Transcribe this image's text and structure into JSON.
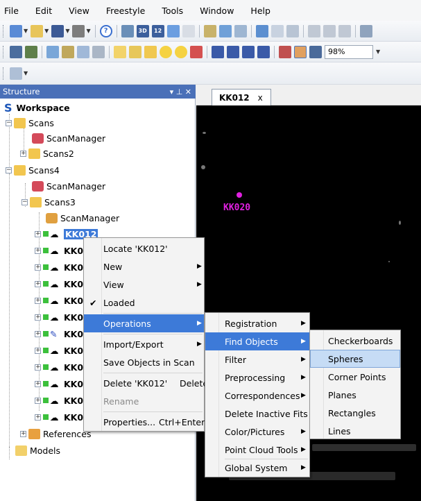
{
  "menubar": [
    "File",
    "Edit",
    "View",
    "Freestyle",
    "Tools",
    "Window",
    "Help"
  ],
  "toolbar": {
    "zoom": "98%",
    "icons": [
      "new-icon",
      "open-icon",
      "save-icon",
      "print-icon",
      "help-icon",
      "scan-icon",
      "3d-icon",
      "12-icon",
      "home-icon"
    ]
  },
  "structure": {
    "title": "Structure",
    "workspace_label": "Workspace",
    "tree": [
      {
        "label": "Scans",
        "bold": false
      },
      {
        "label": "ScanManager",
        "bold": false
      },
      {
        "label": "Scans2",
        "bold": false
      },
      {
        "label": "Scans4",
        "bold": false
      },
      {
        "label": "ScanManager",
        "bold": false
      },
      {
        "label": "Scans3",
        "bold": false
      },
      {
        "label": "ScanManager",
        "bold": false
      },
      {
        "label": "KK012",
        "bold": true,
        "selected": true
      },
      {
        "label": "KK0",
        "bold": true
      },
      {
        "label": "KK0",
        "bold": true
      },
      {
        "label": "KK0",
        "bold": true
      },
      {
        "label": "KK0",
        "bold": true
      },
      {
        "label": "KK0",
        "bold": true
      },
      {
        "label": "KK0",
        "bold": true
      },
      {
        "label": "KK0",
        "bold": true
      },
      {
        "label": "KK0",
        "bold": true
      },
      {
        "label": "KK0",
        "bold": true
      },
      {
        "label": "KK0",
        "bold": true
      },
      {
        "label": "KK020",
        "bold": true
      },
      {
        "label": "References",
        "bold": false
      },
      {
        "label": "Models",
        "bold": false
      }
    ]
  },
  "document": {
    "tab_label": "KK012",
    "tab_close": "x",
    "scan_label": "KK020"
  },
  "context_menu": {
    "items": [
      {
        "label": "Locate 'KK012'"
      },
      {
        "label": "New",
        "submenu": true
      },
      {
        "label": "View",
        "submenu": true
      },
      {
        "label": "Loaded",
        "checked": true
      },
      {
        "label": "Operations",
        "submenu": true,
        "highlighted": true
      },
      {
        "label": "Import/Export",
        "submenu": true
      },
      {
        "label": "Save Objects in Scan"
      },
      {
        "label": "Delete 'KK012'",
        "shortcut": "Delete"
      },
      {
        "label": "Rename",
        "disabled": true
      },
      {
        "label": "Properties...",
        "shortcut": "Ctrl+Enter"
      }
    ],
    "check_mark": "✔"
  },
  "operations_menu": {
    "items": [
      {
        "label": "Registration",
        "submenu": true
      },
      {
        "label": "Find Objects",
        "submenu": true,
        "highlighted": true
      },
      {
        "label": "Filter",
        "submenu": true
      },
      {
        "label": "Preprocessing",
        "submenu": true
      },
      {
        "label": "Correspondences",
        "submenu": true
      },
      {
        "label": "Delete Inactive Fits"
      },
      {
        "label": "Color/Pictures",
        "submenu": true
      },
      {
        "label": "Point Cloud Tools",
        "submenu": true
      },
      {
        "label": "Global System",
        "submenu": true
      }
    ]
  },
  "find_objects_menu": {
    "items": [
      {
        "label": "Checkerboards"
      },
      {
        "label": "Spheres",
        "highlighted": true
      },
      {
        "label": "Corner Points"
      },
      {
        "label": "Planes"
      },
      {
        "label": "Rectangles"
      },
      {
        "label": "Lines"
      }
    ]
  },
  "colors": {
    "accent": "#3d7ad8",
    "header": "#4a70b8",
    "scan_label": "#e020e0"
  }
}
